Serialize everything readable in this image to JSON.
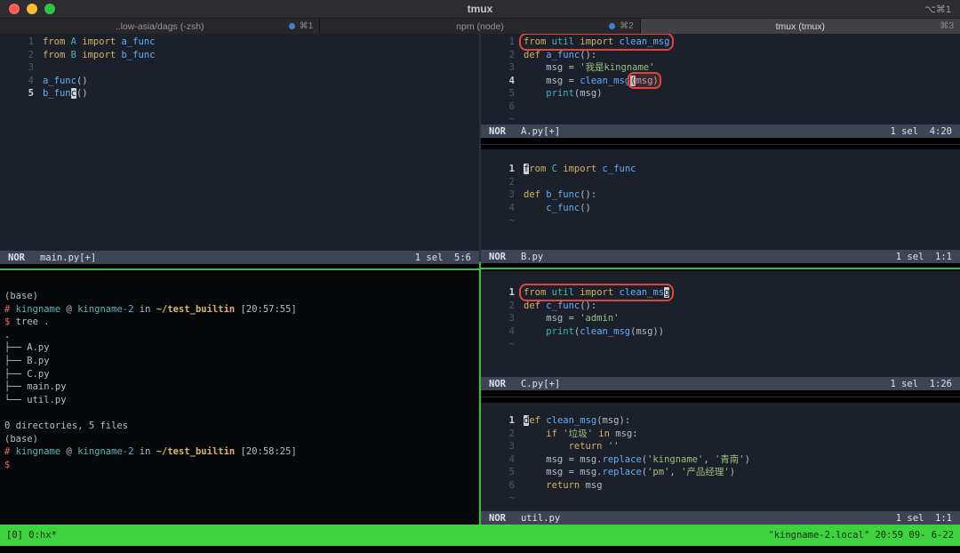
{
  "titlebar": {
    "title": "tmux",
    "shortcut": "⌥⌘1"
  },
  "tabs": [
    {
      "label": "..low-asia/dags (-zsh)",
      "shortcut": "⌘1",
      "dot": true,
      "active": false
    },
    {
      "label": "npm (node)",
      "shortcut": "⌘2",
      "dot": true,
      "active": false
    },
    {
      "label": "tmux (tmux)",
      "shortcut": "⌘3",
      "dot": false,
      "active": true
    }
  ],
  "colors": {
    "annotation_box": "#e0453c",
    "tmux_status_green": "#3fd23f",
    "pane_active_border": "#33c433",
    "editor_background": "#1b202a",
    "statusline_background": "#3d4554",
    "tab_activity_dot": "#3b82d0",
    "traffic_close": "#ff5f57",
    "traffic_minimize": "#febc2e",
    "traffic_zoom": "#28c840"
  },
  "panes": {
    "main_py": {
      "status": {
        "mode": "NOR",
        "file": "main.py[+]",
        "right": "1 sel  5:6"
      },
      "lines": [
        {
          "n": "1",
          "tk": [
            {
              "t": "from",
              "c": "kw"
            },
            {
              "t": " "
            },
            {
              "t": "A",
              "c": "mod"
            },
            {
              "t": " "
            },
            {
              "t": "import",
              "c": "kw"
            },
            {
              "t": " "
            },
            {
              "t": "a_func",
              "c": "fn"
            }
          ]
        },
        {
          "n": "2",
          "tk": [
            {
              "t": "from",
              "c": "kw"
            },
            {
              "t": " "
            },
            {
              "t": "B",
              "c": "mod"
            },
            {
              "t": " "
            },
            {
              "t": "import",
              "c": "kw"
            },
            {
              "t": " "
            },
            {
              "t": "b_func",
              "c": "fn"
            }
          ]
        },
        {
          "n": "3",
          "tk": []
        },
        {
          "n": "4",
          "tk": [
            {
              "t": "a_func",
              "c": "fn"
            },
            {
              "t": "()"
            }
          ]
        },
        {
          "n": "5",
          "cur": true,
          "tk": [
            {
              "t": "b_fun",
              "c": "fn"
            },
            {
              "t": "c",
              "c": "fn",
              "k": true
            },
            {
              "t": "()"
            }
          ]
        }
      ]
    },
    "a_py": {
      "status": {
        "mode": "NOR",
        "file": "A.py[+]",
        "right": "1 sel  4:20"
      },
      "lines": [
        {
          "n": "1",
          "tk": [
            {
              "b": [
                {
                  "t": "from",
                  "c": "kw"
                },
                {
                  "t": " "
                },
                {
                  "t": "util",
                  "c": "mod"
                },
                {
                  "t": " "
                },
                {
                  "t": "import",
                  "c": "kw"
                },
                {
                  "t": " "
                },
                {
                  "t": "clean_msg",
                  "c": "fn"
                }
              ]
            }
          ]
        },
        {
          "n": "2",
          "tk": [
            {
              "t": "def",
              "c": "kw"
            },
            {
              "t": " "
            },
            {
              "t": "a_func",
              "c": "fn"
            },
            {
              "t": "():"
            }
          ]
        },
        {
          "n": "3",
          "tk": [
            {
              "t": "    msg = "
            },
            {
              "t": "'我是kingname'",
              "c": "str"
            }
          ]
        },
        {
          "n": "4",
          "cur": true,
          "tk": [
            {
              "t": "    msg = "
            },
            {
              "t": "clean_msg",
              "c": "fn"
            },
            {
              "b": [
                {
                  "t": "(",
                  "k": true
                },
                {
                  "t": "msg)"
                }
              ],
              "f": true
            }
          ]
        },
        {
          "n": "5",
          "tk": [
            {
              "t": "    "
            },
            {
              "t": "print",
              "c": "bi"
            },
            {
              "t": "(msg)"
            }
          ]
        },
        {
          "n": "6",
          "tk": []
        },
        {
          "tilde": true
        }
      ]
    },
    "b_py": {
      "status": {
        "mode": "NOR",
        "file": "B.py",
        "right": "1 sel  1:1"
      },
      "lines": [
        {
          "n": "1",
          "cur": true,
          "tk": [
            {
              "t": "f",
              "c": "kw",
              "k": true
            },
            {
              "t": "rom",
              "c": "kw"
            },
            {
              "t": " "
            },
            {
              "t": "C",
              "c": "mod"
            },
            {
              "t": " "
            },
            {
              "t": "import",
              "c": "kw"
            },
            {
              "t": " "
            },
            {
              "t": "c_func",
              "c": "fn"
            }
          ]
        },
        {
          "n": "2",
          "tk": []
        },
        {
          "n": "3",
          "tk": [
            {
              "t": "def",
              "c": "kw"
            },
            {
              "t": " "
            },
            {
              "t": "b_func",
              "c": "fn"
            },
            {
              "t": "():"
            }
          ]
        },
        {
          "n": "4",
          "tk": [
            {
              "t": "    "
            },
            {
              "t": "c_func",
              "c": "fn"
            },
            {
              "t": "()"
            }
          ]
        },
        {
          "tilde": true
        }
      ]
    },
    "c_py": {
      "status": {
        "mode": "NOR",
        "file": "C.py[+]",
        "right": "1 sel  1:26"
      },
      "lines": [
        {
          "n": "1",
          "cur": true,
          "tk": [
            {
              "b": [
                {
                  "t": "from",
                  "c": "kw"
                },
                {
                  "t": " "
                },
                {
                  "t": "util",
                  "c": "mod"
                },
                {
                  "t": " "
                },
                {
                  "t": "import",
                  "c": "kw"
                },
                {
                  "t": " "
                },
                {
                  "t": "clean_ms",
                  "c": "fn"
                },
                {
                  "t": "g",
                  "c": "fn",
                  "k": true
                }
              ]
            }
          ]
        },
        {
          "n": "2",
          "tk": [
            {
              "t": "def",
              "c": "kw"
            },
            {
              "t": " "
            },
            {
              "t": "c_func",
              "c": "fn"
            },
            {
              "t": "():"
            }
          ]
        },
        {
          "n": "3",
          "tk": [
            {
              "t": "    msg = "
            },
            {
              "t": "'admin'",
              "c": "str"
            }
          ]
        },
        {
          "n": "4",
          "tk": [
            {
              "t": "    "
            },
            {
              "t": "print",
              "c": "bi"
            },
            {
              "t": "("
            },
            {
              "t": "clean_msg",
              "c": "fn"
            },
            {
              "t": "(msg))"
            }
          ]
        },
        {
          "tilde": true
        }
      ]
    },
    "util_py": {
      "status": {
        "mode": "NOR",
        "file": "util.py",
        "right": "1 sel  1:1"
      },
      "lines": [
        {
          "n": "1",
          "cur": true,
          "tk": [
            {
              "t": "d",
              "c": "kw",
              "k": true
            },
            {
              "t": "ef",
              "c": "kw"
            },
            {
              "t": " "
            },
            {
              "t": "clean_msg",
              "c": "fn"
            },
            {
              "t": "(msg):"
            }
          ]
        },
        {
          "n": "2",
          "tk": [
            {
              "t": "    "
            },
            {
              "t": "if",
              "c": "kw"
            },
            {
              "t": " "
            },
            {
              "t": "'垃圾'",
              "c": "str"
            },
            {
              "t": " "
            },
            {
              "t": "in",
              "c": "kw"
            },
            {
              "t": " msg:"
            }
          ]
        },
        {
          "n": "3",
          "tk": [
            {
              "t": "        "
            },
            {
              "t": "return",
              "c": "kw"
            },
            {
              "t": " "
            },
            {
              "t": "''",
              "c": "str"
            }
          ]
        },
        {
          "n": "4",
          "tk": [
            {
              "t": "    msg = msg."
            },
            {
              "t": "replace",
              "c": "fn"
            },
            {
              "t": "("
            },
            {
              "t": "'kingname'",
              "c": "str"
            },
            {
              "t": ", "
            },
            {
              "t": "'青南'",
              "c": "str"
            },
            {
              "t": ")"
            }
          ]
        },
        {
          "n": "5",
          "tk": [
            {
              "t": "    msg = msg."
            },
            {
              "t": "replace",
              "c": "fn"
            },
            {
              "t": "("
            },
            {
              "t": "'pm'",
              "c": "str"
            },
            {
              "t": ", "
            },
            {
              "t": "'产品经理'",
              "c": "str"
            },
            {
              "t": ")"
            }
          ]
        },
        {
          "n": "6",
          "tk": [
            {
              "t": "    "
            },
            {
              "t": "return",
              "c": "kw"
            },
            {
              "t": " msg"
            }
          ]
        },
        {
          "tilde": true
        }
      ]
    },
    "shell": {
      "lines": [
        [
          {
            "t": "(base)"
          }
        ],
        [
          {
            "t": "# ",
            "c": "red"
          },
          {
            "t": "kingname",
            "c": "cyan"
          },
          {
            "t": " @ "
          },
          {
            "t": "kingname-2",
            "c": "cyan"
          },
          {
            "t": " in "
          },
          {
            "t": "~/test_builtin",
            "c": "path"
          },
          {
            "t": " [20:57:55]"
          }
        ],
        [
          {
            "t": "$ ",
            "c": "red"
          },
          {
            "t": "tree ."
          }
        ],
        [
          {
            "t": "."
          }
        ],
        [
          {
            "t": "├── A.py"
          }
        ],
        [
          {
            "t": "├── B.py"
          }
        ],
        [
          {
            "t": "├── C.py"
          }
        ],
        [
          {
            "t": "├── main.py"
          }
        ],
        [
          {
            "t": "└── util.py"
          }
        ],
        [],
        [
          {
            "t": "0 directories, 5 files"
          }
        ],
        [
          {
            "t": "(base)"
          }
        ],
        [
          {
            "t": "# ",
            "c": "red"
          },
          {
            "t": "kingname",
            "c": "cyan"
          },
          {
            "t": " @ "
          },
          {
            "t": "kingname-2",
            "c": "cyan"
          },
          {
            "t": " in "
          },
          {
            "t": "~/test_builtin",
            "c": "path"
          },
          {
            "t": " [20:58:25]"
          }
        ],
        [
          {
            "t": "$",
            "c": "red"
          }
        ]
      ]
    }
  },
  "tmux_status": {
    "left": "[0] 0:hx*",
    "right": "\"kingname-2.local\" 20:59 09- 6-22"
  }
}
